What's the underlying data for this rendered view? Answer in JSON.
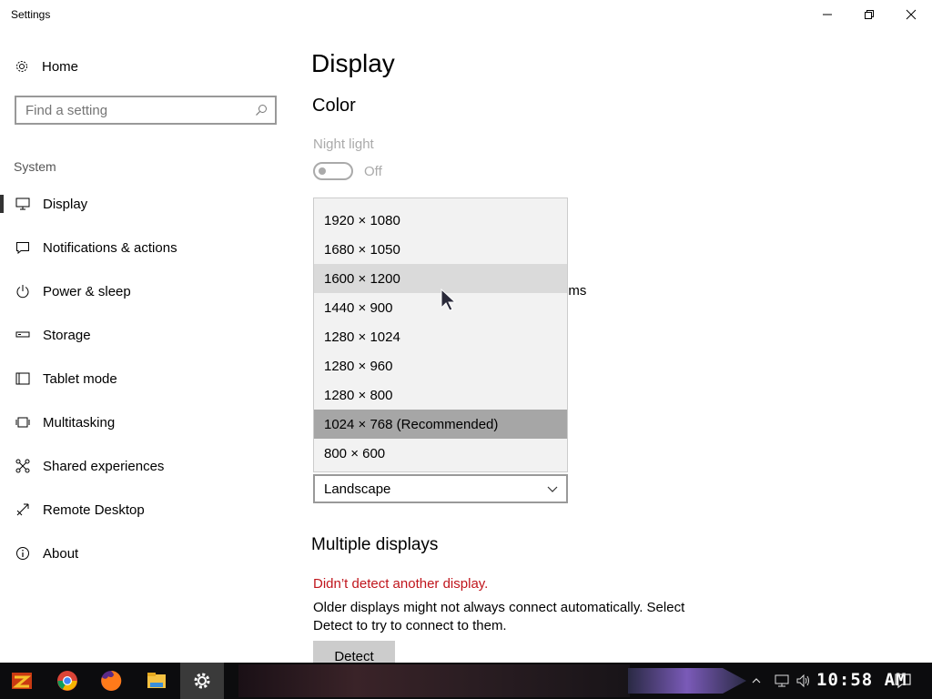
{
  "window": {
    "title": "Settings"
  },
  "sidebar": {
    "home_label": "Home",
    "search_placeholder": "Find a setting",
    "section_label": "System",
    "items": [
      {
        "label": "Display",
        "icon": "monitor-icon",
        "active": true
      },
      {
        "label": "Notifications & actions",
        "icon": "notification-icon"
      },
      {
        "label": "Power & sleep",
        "icon": "power-icon"
      },
      {
        "label": "Storage",
        "icon": "storage-icon"
      },
      {
        "label": "Tablet mode",
        "icon": "tablet-icon"
      },
      {
        "label": "Multitasking",
        "icon": "multitasking-icon"
      },
      {
        "label": "Shared experiences",
        "icon": "shared-experiences-icon"
      },
      {
        "label": "Remote Desktop",
        "icon": "remote-desktop-icon"
      },
      {
        "label": "About",
        "icon": "info-icon"
      }
    ]
  },
  "main": {
    "title": "Display",
    "color_section": "Color",
    "night_light_label": "Night light",
    "night_light_state": "Off",
    "partial_text": "ems",
    "resolution_options": [
      "1920 × 1080",
      "1680 × 1050",
      "1600 × 1200",
      "1440 × 900",
      "1280 × 1024",
      "1280 × 960",
      "1280 × 800",
      "1024 × 768 (Recommended)",
      "800 × 600"
    ],
    "hovered_option": "1600 × 1200",
    "selected_option": "1024 × 768 (Recommended)",
    "orientation_value": "Landscape",
    "multiple_displays_title": "Multiple displays",
    "error_message": "Didn’t detect another display.",
    "description": "Older displays might not always connect automatically. Select Detect to try to connect to them.",
    "detect_button": "Detect"
  },
  "taskbar": {
    "apps": [
      "start-icon",
      "chrome-icon",
      "firefox-icon",
      "file-explorer-icon",
      "settings-icon"
    ],
    "clock": "10:58 AM"
  },
  "colors": {
    "error": "#c0151c",
    "selected_option_bg": "#a6a6a6",
    "hover_option_bg": "#dadada",
    "taskbar_bg": "#0c0c0e"
  }
}
